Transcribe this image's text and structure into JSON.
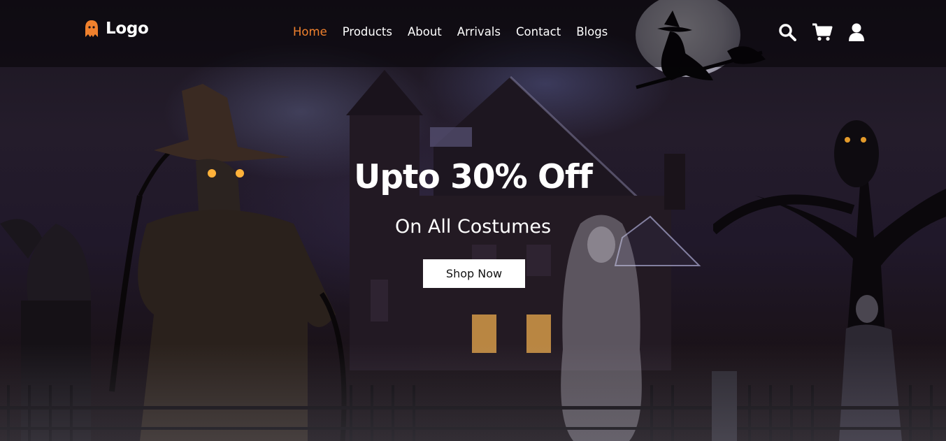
{
  "brand": {
    "name": "Logo",
    "icon": "ghost-icon",
    "accent_color": "#f0812d"
  },
  "nav": {
    "items": [
      {
        "label": "Home",
        "active": true
      },
      {
        "label": "Products",
        "active": false
      },
      {
        "label": "About",
        "active": false
      },
      {
        "label": "Arrivals",
        "active": false
      },
      {
        "label": "Contact",
        "active": false
      },
      {
        "label": "Blogs",
        "active": false
      }
    ],
    "active_color": "#f0812d",
    "text_color": "#ffffff"
  },
  "header_icons": [
    "search-icon",
    "cart-icon",
    "user-icon"
  ],
  "hero": {
    "title": "Upto 30% Off",
    "subtitle": "On All Costumes",
    "cta_label": "Shop Now",
    "background": "haunted-house-scene"
  }
}
